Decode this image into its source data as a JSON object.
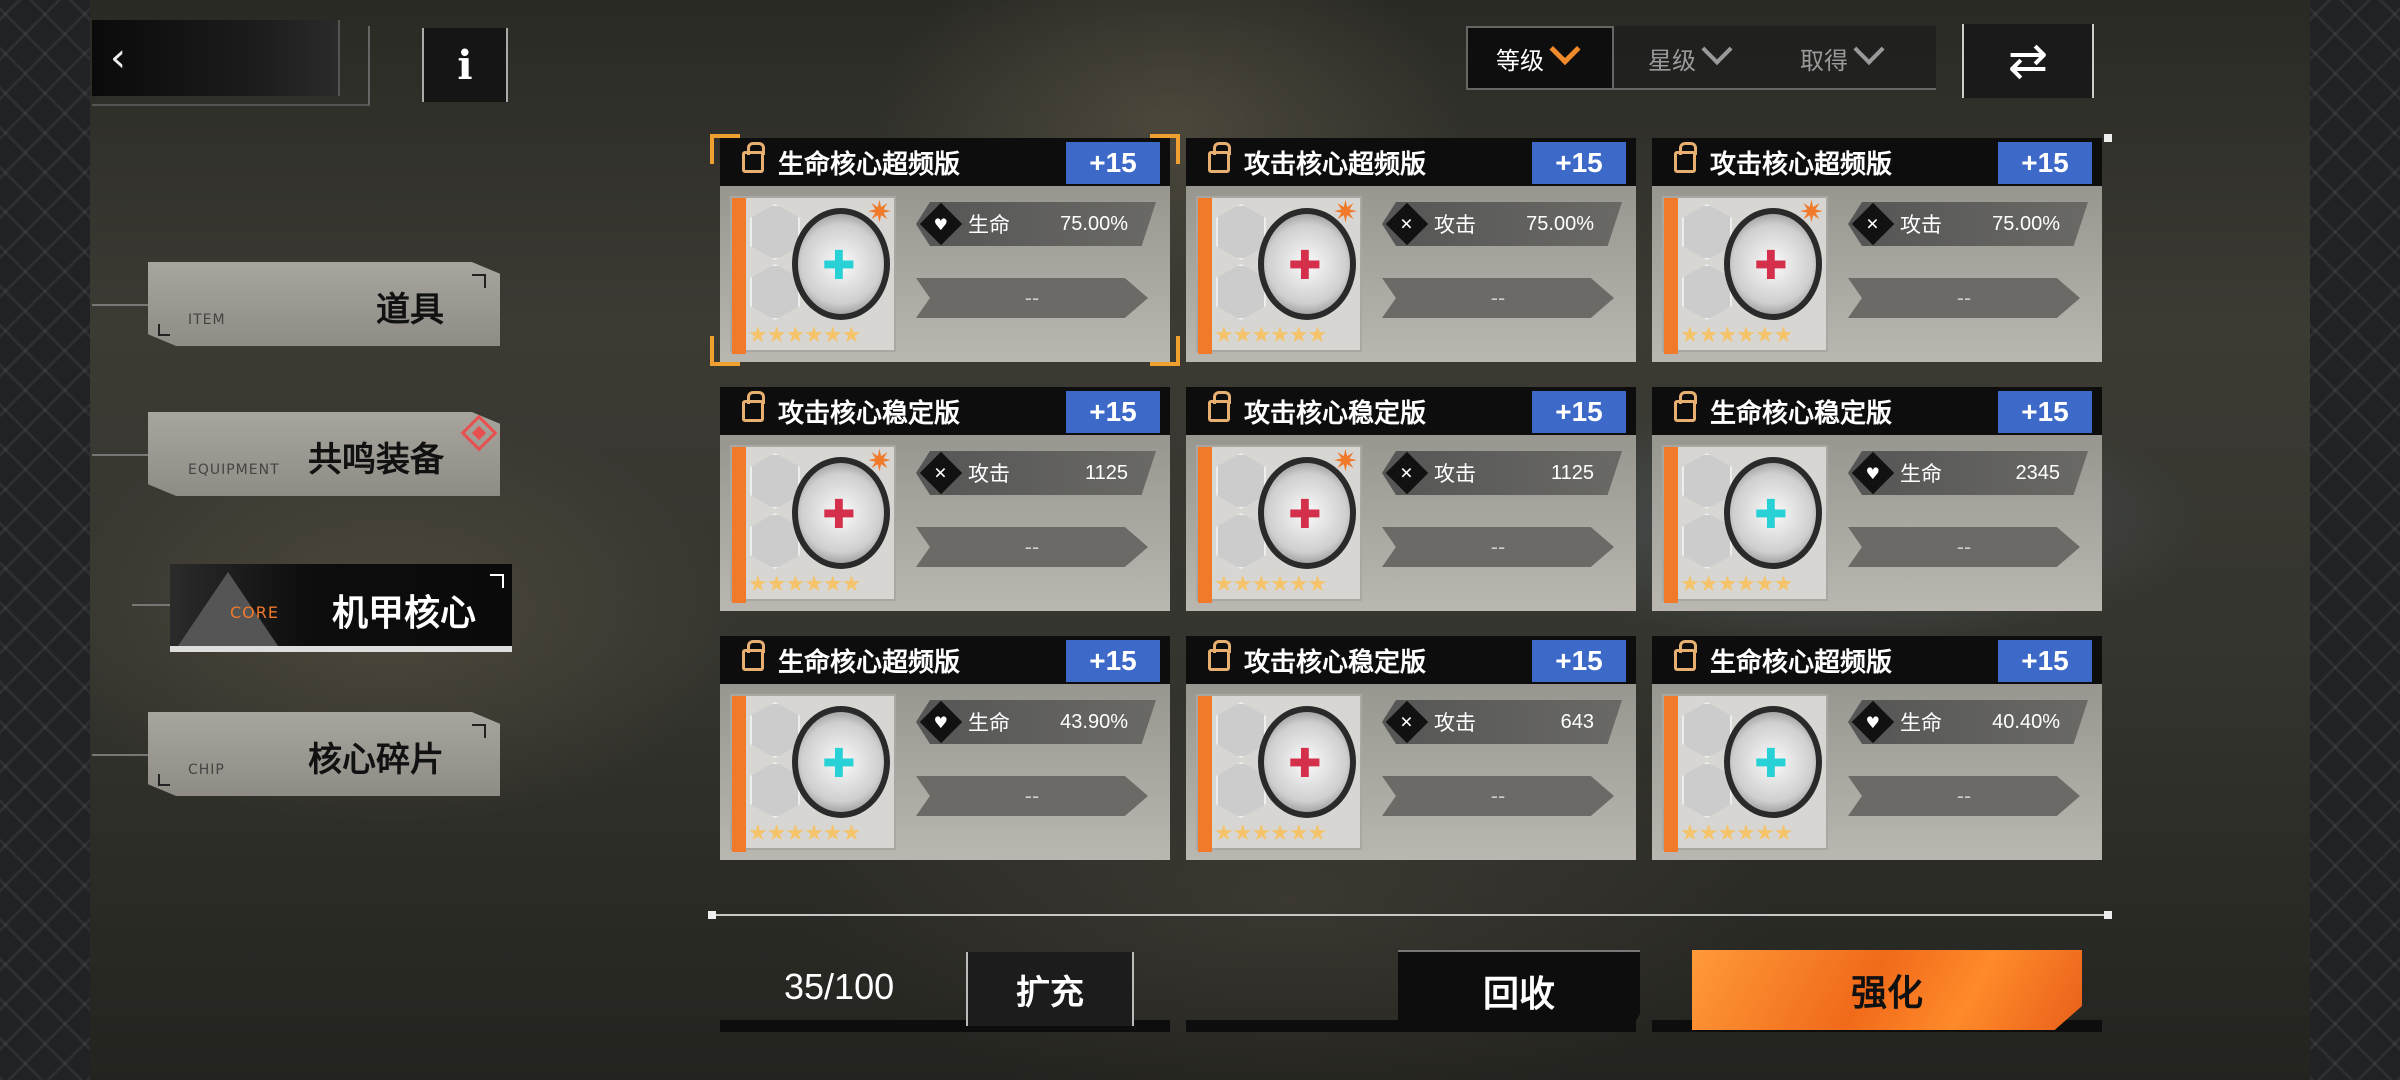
{
  "top": {
    "back_icon": "chevron-left-icon",
    "info_label": "i"
  },
  "nav": {
    "items": [
      {
        "en": "ITEM",
        "cn": "道具"
      },
      {
        "en": "EQUIPMENT",
        "cn": "共鸣装备"
      },
      {
        "en": "CORE",
        "cn": "机甲核心"
      },
      {
        "en": "CHIP",
        "cn": "核心碎片"
      }
    ]
  },
  "sort": {
    "options": [
      "等级",
      "星级",
      "取得"
    ],
    "active": "等级",
    "swap_icon": "⇄"
  },
  "colors": {
    "accent_orange": "#f07a2a",
    "level_badge_blue": "#3d69c9",
    "heal_cross": "#27d1d6",
    "attack_cross": "#d4304c"
  },
  "cards": [
    {
      "name": "生命核心超频版",
      "level": "+15",
      "stat_label": "生命",
      "stat_icon": "heart-icon",
      "stat_value": "75.00%",
      "sub_value": "--",
      "type": "heal",
      "stars": "★★★★★★",
      "spark": true,
      "selected": true
    },
    {
      "name": "攻击核心超频版",
      "level": "+15",
      "stat_label": "攻击",
      "stat_icon": "crossed-swords-icon",
      "stat_value": "75.00%",
      "sub_value": "--",
      "type": "attack",
      "stars": "★★★★★★",
      "spark": true,
      "selected": false
    },
    {
      "name": "攻击核心超频版",
      "level": "+15",
      "stat_label": "攻击",
      "stat_icon": "crossed-swords-icon",
      "stat_value": "75.00%",
      "sub_value": "--",
      "type": "attack",
      "stars": "★★★★★★",
      "spark": true,
      "selected": false
    },
    {
      "name": "攻击核心稳定版",
      "level": "+15",
      "stat_label": "攻击",
      "stat_icon": "crossed-swords-icon",
      "stat_value": "1125",
      "sub_value": "--",
      "type": "attack",
      "stars": "★★★★★★",
      "spark": true,
      "selected": false
    },
    {
      "name": "攻击核心稳定版",
      "level": "+15",
      "stat_label": "攻击",
      "stat_icon": "crossed-swords-icon",
      "stat_value": "1125",
      "sub_value": "--",
      "type": "attack",
      "stars": "★★★★★★",
      "spark": true,
      "selected": false
    },
    {
      "name": "生命核心稳定版",
      "level": "+15",
      "stat_label": "生命",
      "stat_icon": "heart-icon",
      "stat_value": "2345",
      "sub_value": "--",
      "type": "heal",
      "stars": "★★★★★★",
      "spark": false,
      "selected": false
    },
    {
      "name": "生命核心超频版",
      "level": "+15",
      "stat_label": "生命",
      "stat_icon": "heart-icon",
      "stat_value": "43.90%",
      "sub_value": "--",
      "type": "heal",
      "stars": "★★★★★★",
      "spark": false,
      "selected": false
    },
    {
      "name": "攻击核心稳定版",
      "level": "+15",
      "stat_label": "攻击",
      "stat_icon": "crossed-swords-icon",
      "stat_value": "643",
      "sub_value": "--",
      "type": "attack",
      "stars": "★★★★★★",
      "spark": false,
      "selected": false
    },
    {
      "name": "生命核心超频版",
      "level": "+15",
      "stat_label": "生命",
      "stat_icon": "heart-icon",
      "stat_value": "40.40%",
      "sub_value": "--",
      "type": "heal",
      "stars": "★★★★★★",
      "spark": false,
      "selected": false
    }
  ],
  "bottom": {
    "capacity": "35/100",
    "expand_label": "扩充",
    "recycle_label": "回收",
    "enhance_label": "强化"
  }
}
